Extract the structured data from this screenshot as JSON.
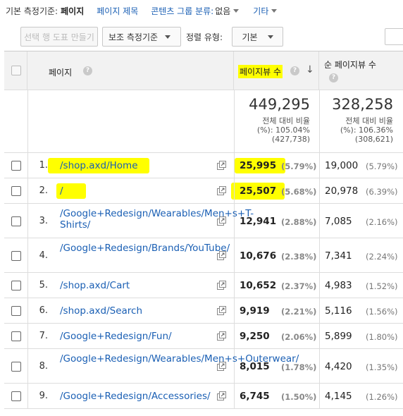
{
  "dimension_bar": {
    "label": "기본 측정기준:",
    "active": "페이지",
    "link1": "페이지 제목",
    "link2_label": "콘텐츠 그룹 분류:",
    "link2_value": "없음",
    "link3": "기타"
  },
  "toolbar": {
    "plot_rows": "선택 행 도표 만들기",
    "secondary_dimension": "보조 측정기준",
    "sort_label": "정렬 유형:",
    "sort_value": "기본"
  },
  "table": {
    "header": {
      "page": "페이지",
      "pageviews": "페이지뷰 수",
      "unique_pageviews": "순 페이지뷰 수",
      "help": "?"
    },
    "totals": {
      "pageviews": "449,295",
      "pageviews_line1": "전체 대비 비율",
      "pageviews_line2": "(%): 105.04%",
      "pageviews_line3": "(427,738)",
      "unique": "328,258",
      "unique_line1": "전체 대비 비율",
      "unique_line2": "(%): 106.36%",
      "unique_line3": "(308,621)"
    },
    "rows": [
      {
        "idx": "1.",
        "page": "/shop.axd/Home",
        "pv": "25,995",
        "pv_pct": "(5.79%)",
        "upv": "19,000",
        "upv_pct": "(5.79%)"
      },
      {
        "idx": "2.",
        "page": "/",
        "pv": "25,507",
        "pv_pct": "(5.68%)",
        "upv": "20,978",
        "upv_pct": "(6.39%)"
      },
      {
        "idx": "3.",
        "page": "/Google+Redesign/Wearables/Men+s+T-Shirts/",
        "pv": "12,941",
        "pv_pct": "(2.88%)",
        "upv": "7,085",
        "upv_pct": "(2.16%)"
      },
      {
        "idx": "4.",
        "page": "/Google+Redesign/Brands/YouTube/",
        "pv": "10,676",
        "pv_pct": "(2.38%)",
        "upv": "7,341",
        "upv_pct": "(2.24%)"
      },
      {
        "idx": "5.",
        "page": "/shop.axd/Cart",
        "pv": "10,652",
        "pv_pct": "(2.37%)",
        "upv": "4,983",
        "upv_pct": "(1.52%)"
      },
      {
        "idx": "6.",
        "page": "/shop.axd/Search",
        "pv": "9,919",
        "pv_pct": "(2.21%)",
        "upv": "5,116",
        "upv_pct": "(1.56%)"
      },
      {
        "idx": "7.",
        "page": "/Google+Redesign/Fun/",
        "pv": "9,250",
        "pv_pct": "(2.06%)",
        "upv": "5,899",
        "upv_pct": "(1.80%)"
      },
      {
        "idx": "8.",
        "page": "/Google+Redesign/Wearables/Men+s+Outerwear/",
        "pv": "8,015",
        "pv_pct": "(1.78%)",
        "upv": "4,420",
        "upv_pct": "(1.35%)"
      },
      {
        "idx": "9.",
        "page": "/Google+Redesign/Accessories/",
        "pv": "6,745",
        "pv_pct": "(1.50%)",
        "upv": "4,145",
        "upv_pct": "(1.26%)"
      }
    ]
  },
  "colors": {
    "link": "#1a5fb4",
    "highlight": "#ffff00",
    "header_bg": "#f2f2f2"
  }
}
